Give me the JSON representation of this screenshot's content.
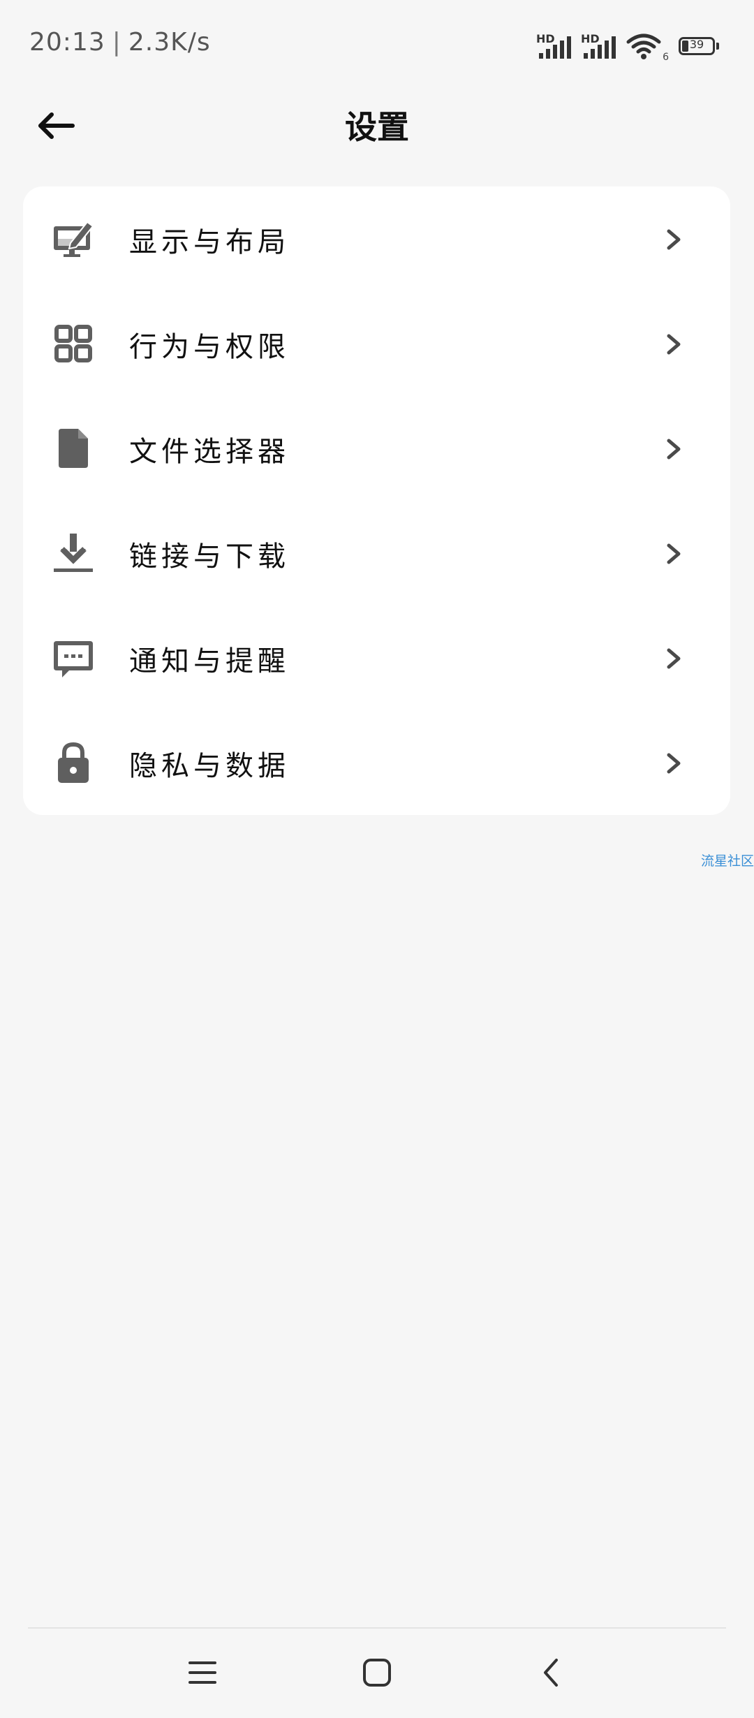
{
  "status_bar": {
    "time": "20:13",
    "separator": "|",
    "net_speed": "2.3K/s",
    "signal1_label": "HD",
    "signal2_label": "HD",
    "wifi_sub": "6",
    "battery_level": "39"
  },
  "header": {
    "title": "设置",
    "back_icon": "arrow-left-icon"
  },
  "menu": {
    "items": [
      {
        "label": "显示与布局",
        "icon": "monitor-edit-icon"
      },
      {
        "label": "行为与权限",
        "icon": "grid-icon"
      },
      {
        "label": "文件选择器",
        "icon": "file-icon"
      },
      {
        "label": "链接与下载",
        "icon": "download-icon"
      },
      {
        "label": "通知与提醒",
        "icon": "message-icon"
      },
      {
        "label": "隐私与数据",
        "icon": "lock-icon"
      }
    ]
  },
  "watermark": "流星社区",
  "nav": {
    "menu_icon": "menu-icon",
    "home_icon": "home-icon",
    "back_icon": "back-chevron-icon"
  },
  "colors": {
    "background": "#f6f6f6",
    "card": "#ffffff",
    "icon": "#5f5f5f",
    "watermark": "#3a8fd6"
  }
}
